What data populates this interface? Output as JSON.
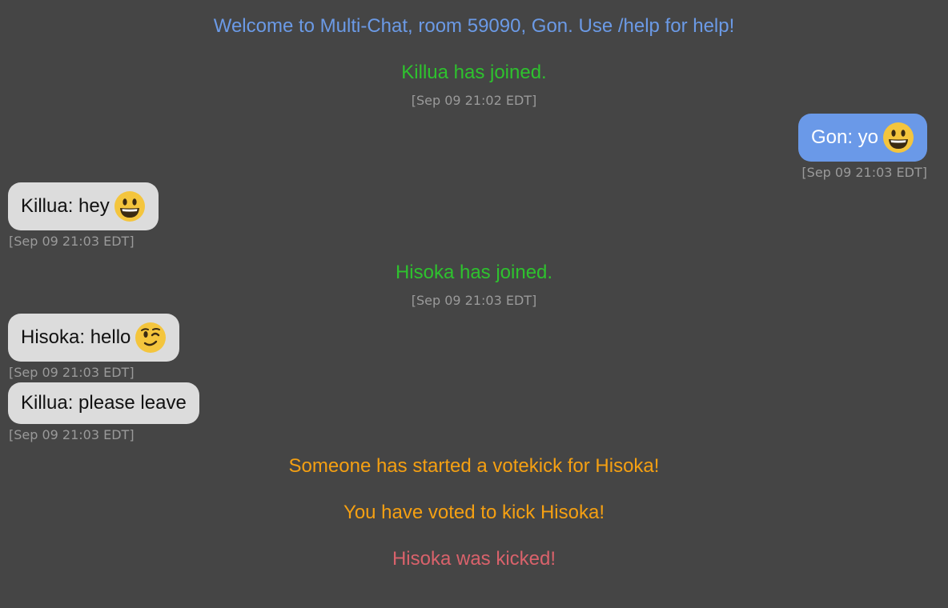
{
  "colors": {
    "background": "#454545",
    "welcome": "#6b9ae6",
    "join": "#2ec22e",
    "vote": "#f5a012",
    "kicked": "#d9626b",
    "bubble_self": "#6a99e8",
    "bubble_other": "#dcdcdc",
    "timestamp": "#9a9a9a"
  },
  "system": {
    "welcome": "Welcome to Multi-Chat, room 59090, Gon. Use /help for help!",
    "killua_joined": "Killua has joined.",
    "killua_joined_time": "[Sep 09 21:02 EDT]",
    "hisoka_joined": "Hisoka has joined.",
    "hisoka_joined_time": "[Sep 09 21:03 EDT]",
    "votekick_started": "Someone has started a votekick for Hisoka!",
    "voted": "You have voted to kick Hisoka!",
    "kicked": "Hisoka was kicked!"
  },
  "messages": [
    {
      "text": "Gon: yo",
      "emoji": "grinning-face-icon",
      "time": "[Sep 09 21:03 EDT]",
      "from_self": true
    },
    {
      "text": "Killua: hey",
      "emoji": "grinning-face-icon",
      "time": "[Sep 09 21:03 EDT]",
      "from_self": false
    },
    {
      "text": "Hisoka: hello",
      "emoji": "winking-face-icon",
      "time": "[Sep 09 21:03 EDT]",
      "from_self": false
    },
    {
      "text": "Killua: please leave",
      "time": "[Sep 09 21:03 EDT]",
      "from_self": false
    }
  ]
}
